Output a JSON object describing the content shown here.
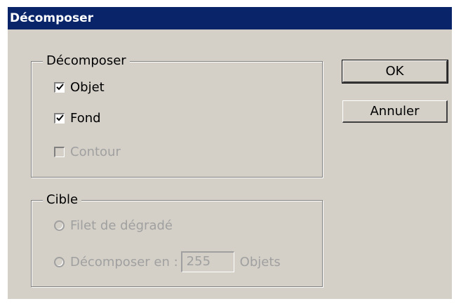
{
  "window": {
    "title": "Décomposer",
    "title_bar_color": "#0a246a",
    "dialog_bg": "#d4d0c8"
  },
  "decompose_group": {
    "legend": "Décomposer",
    "options": [
      {
        "label": "Objet",
        "checked": true,
        "enabled": true
      },
      {
        "label": "Fond",
        "checked": true,
        "enabled": true
      },
      {
        "label": "Contour",
        "checked": false,
        "enabled": false
      }
    ]
  },
  "target_group": {
    "legend": "Cible",
    "options": [
      {
        "label": "Filet de dégradé",
        "selected": false,
        "enabled": false
      },
      {
        "label": "Décomposer en :",
        "selected": false,
        "enabled": false
      }
    ],
    "count_value": "255",
    "count_unit": "Objets"
  },
  "buttons": {
    "ok": "OK",
    "cancel": "Annuler"
  }
}
